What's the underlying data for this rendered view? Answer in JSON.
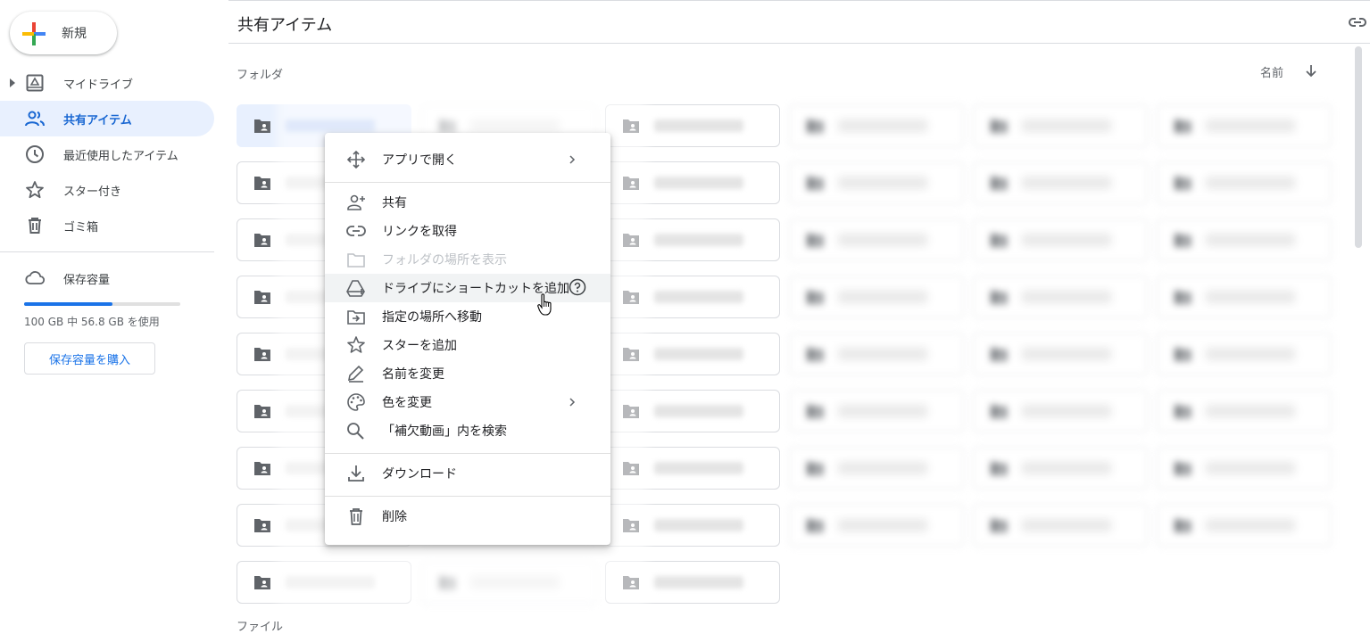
{
  "sidebar": {
    "new_button": "新規",
    "nav": [
      {
        "label": "マイドライブ",
        "icon": "my-drive-icon"
      },
      {
        "label": "共有アイテム",
        "icon": "shared-people-icon",
        "active": true
      },
      {
        "label": "最近使用したアイテム",
        "icon": "clock-icon"
      },
      {
        "label": "スター付き",
        "icon": "star-icon"
      },
      {
        "label": "ゴミ箱",
        "icon": "trash-icon"
      }
    ],
    "storage": {
      "label": "保存容量",
      "usage_text": "100 GB 中 56.8 GB を使用",
      "used_fraction": 0.568,
      "buy_button": "保存容量を購入"
    }
  },
  "header": {
    "title": "共有アイテム",
    "link_icon": "link-icon"
  },
  "main": {
    "folders_label": "フォルダ",
    "files_label": "ファイル",
    "sort": {
      "label": "名前",
      "direction_icon": "arrow-down-icon"
    }
  },
  "context_menu": {
    "items": [
      {
        "label": "アプリで開く",
        "icon": "open-with-icon",
        "submenu": true
      },
      {
        "label": "共有",
        "icon": "person-add-icon"
      },
      {
        "label": "リンクを取得",
        "icon": "link-icon"
      },
      {
        "label": "フォルダの場所を表示",
        "icon": "folder-outline-icon",
        "disabled": true
      },
      {
        "label": "ドライブにショートカットを追加",
        "icon": "drive-shortcut-icon",
        "hover": true,
        "help": true
      },
      {
        "label": "指定の場所へ移動",
        "icon": "move-to-folder-icon"
      },
      {
        "label": "スターを追加",
        "icon": "star-outline-icon"
      },
      {
        "label": "名前を変更",
        "icon": "pencil-icon"
      },
      {
        "label": "色を変更",
        "icon": "palette-icon",
        "submenu": true
      },
      {
        "label": "「補欠動画」内を検索",
        "icon": "search-icon"
      },
      {
        "label": "ダウンロード",
        "icon": "download-icon"
      },
      {
        "label": "削除",
        "icon": "trash-icon"
      }
    ]
  },
  "colors": {
    "accent": "#1a73e8",
    "active_bg": "#e8f0fe",
    "active_text": "#1967d2"
  }
}
